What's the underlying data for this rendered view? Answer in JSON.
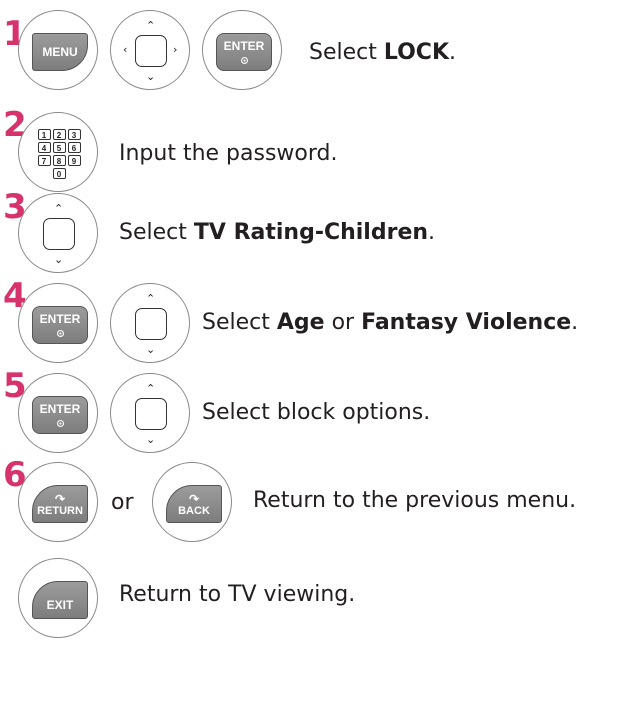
{
  "steps": [
    {
      "number": "1",
      "keys": [
        "MENU",
        "navigation",
        "ENTER"
      ],
      "text": "Select ",
      "bold": "LOCK",
      "suffix": "."
    },
    {
      "number": "2",
      "keypad": [
        [
          "1",
          "2",
          "3"
        ],
        [
          "4",
          "5",
          "6"
        ],
        [
          "7",
          "8",
          "9"
        ],
        [
          "0"
        ]
      ],
      "text": "Input the password."
    },
    {
      "number": "3",
      "keys": [
        "navigation"
      ],
      "text": "Select ",
      "bold": "TV Rating-Children",
      "suffix": "."
    },
    {
      "number": "4",
      "keys": [
        "ENTER",
        "navigation"
      ],
      "text": "Select ",
      "bold": "Age",
      "middle": " or ",
      "bold2": "Fantasy Violence",
      "suffix": "."
    },
    {
      "number": "5",
      "keys": [
        "ENTER",
        "navigation"
      ],
      "text": "Select block options."
    },
    {
      "number": "6",
      "keys": [
        "RETURN",
        "BACK"
      ],
      "connector": "or",
      "text": "Return to the previous menu."
    },
    {
      "number": "",
      "keys": [
        "EXIT"
      ],
      "text": "Return to TV viewing."
    }
  ],
  "colors": {
    "step_number": "#d6336c",
    "key_fill": "#8d8d8d",
    "text": "#231f20"
  },
  "icons": [
    "menu-key-icon",
    "navigation-pad-icon",
    "enter-key-icon",
    "number-keypad-icon",
    "return-key-icon",
    "back-key-icon",
    "exit-key-icon"
  ]
}
